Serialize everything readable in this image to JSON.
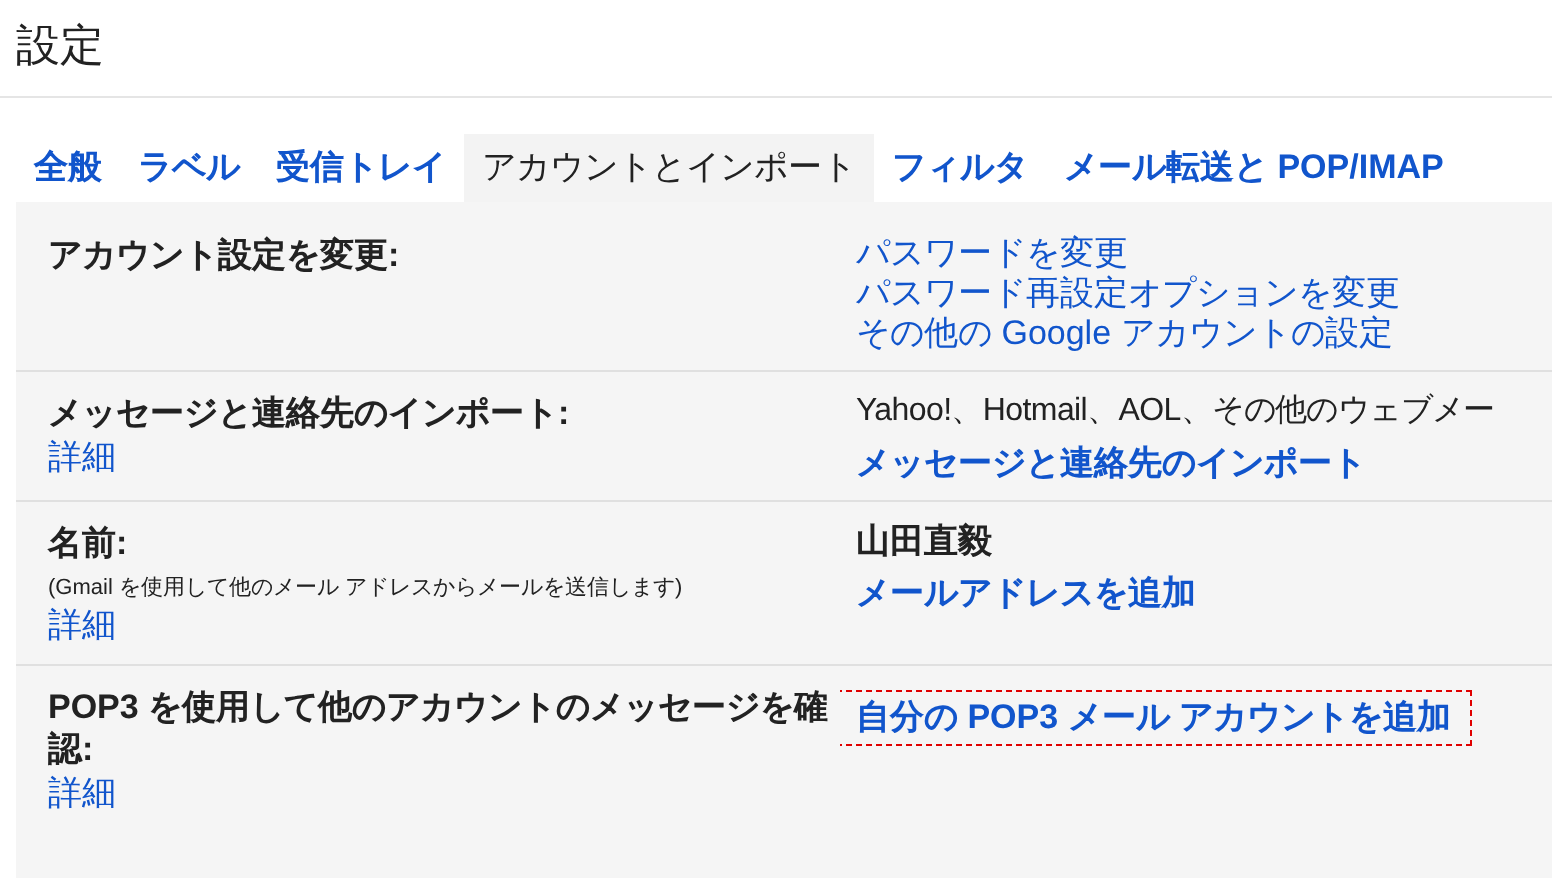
{
  "page_title": "設定",
  "tabs": [
    {
      "label": "全般",
      "selected": false
    },
    {
      "label": "ラベル",
      "selected": false
    },
    {
      "label": "受信トレイ",
      "selected": false
    },
    {
      "label": "アカウントとインポート",
      "selected": true
    },
    {
      "label": "フィルタ",
      "selected": false
    },
    {
      "label": "メール転送と POP/IMAP",
      "selected": false
    }
  ],
  "sections": [
    {
      "label": "アカウント設定を変更:",
      "items": [
        {
          "kind": "link",
          "text": "パスワードを変更",
          "highlighted": false
        },
        {
          "kind": "link",
          "text": "パスワード再設定オプションを変更",
          "highlighted": false
        },
        {
          "kind": "link",
          "text": "その他の Google アカウントの設定",
          "highlighted": false
        }
      ]
    },
    {
      "label": "メッセージと連絡先のインポート:",
      "details_link": "詳細",
      "items": [
        {
          "kind": "text",
          "text": "Yahoo!、Hotmail、AOL、その他のウェブメー",
          "highlighted": false
        },
        {
          "kind": "strong_link",
          "text": "メッセージと連絡先のインポート",
          "highlighted": false
        }
      ]
    },
    {
      "label": "名前:",
      "note": "(Gmail を使用して他のメール アドレスからメールを送信します)",
      "details_link": "詳細",
      "items": [
        {
          "kind": "strong_text",
          "text": "山田直毅",
          "highlighted": false
        },
        {
          "kind": "strong_link",
          "text": "メールアドレスを追加",
          "highlighted": false
        }
      ]
    },
    {
      "label": "POP3 を使用して他のアカウントのメッセージを確認:",
      "details_link": "詳細",
      "items": [
        {
          "kind": "strong_link",
          "text": "自分の POP3 メール アカウントを追加",
          "highlighted": true
        }
      ]
    }
  ]
}
